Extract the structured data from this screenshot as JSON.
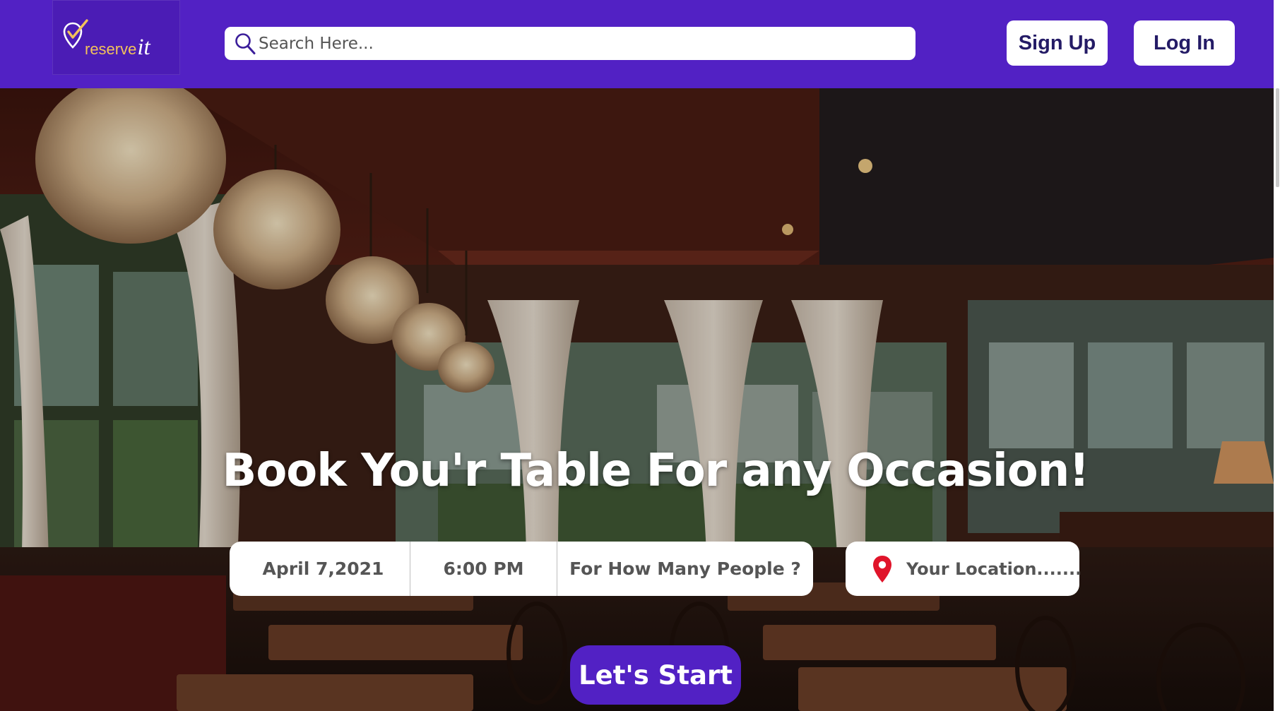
{
  "header": {
    "logo": {
      "brand": "reserve",
      "brand_suffix": "it"
    },
    "search": {
      "placeholder": "Search Here..."
    },
    "signup_label": "Sign Up",
    "login_label": "Log In"
  },
  "hero": {
    "headline": "Book You'r Table For any Occasion!",
    "booking": {
      "date": "April 7,2021",
      "time": "6:00 PM",
      "people": "For How Many People ?"
    },
    "location": {
      "placeholder": "Your Location......."
    },
    "cta_label": "Let's Start"
  },
  "colors": {
    "brand_purple": "#5221c4",
    "logo_gold": "#f3c25a",
    "pin_red": "#e0142a",
    "auth_text": "#241b66"
  },
  "icons": {
    "search": "search-icon",
    "location": "location-pin-icon",
    "logo": "check-pin-logo-icon"
  }
}
